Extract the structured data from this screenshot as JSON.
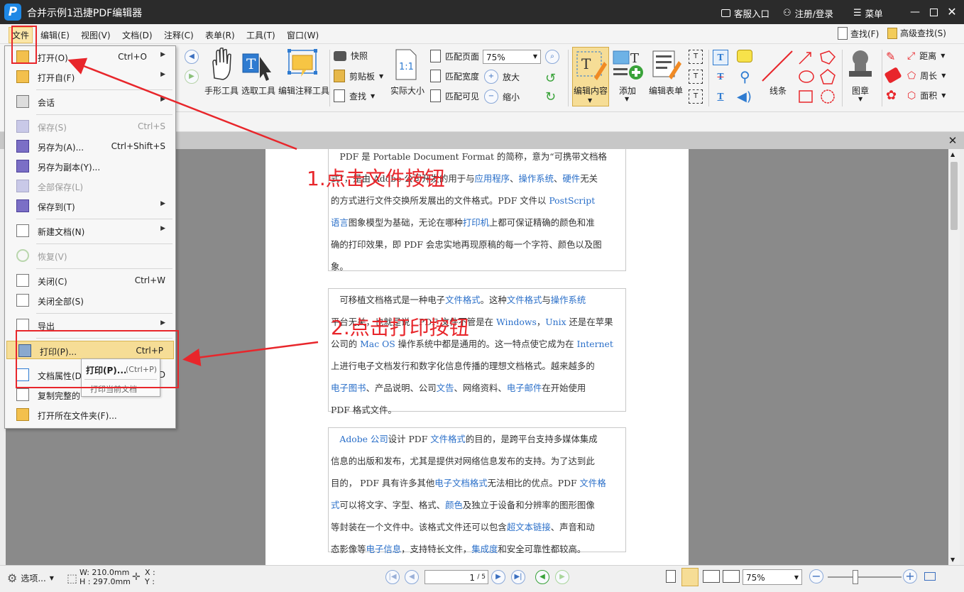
{
  "titlebar": {
    "logo": "P",
    "title": "合并示例1迅捷PDF编辑器",
    "service": "客服入口",
    "login": "注册/登录",
    "menu": "菜单"
  },
  "menubar": {
    "items": [
      "文件",
      "编辑(E)",
      "视图(V)",
      "文档(D)",
      "注释(C)",
      "表单(R)",
      "工具(T)",
      "窗口(W)"
    ],
    "find": "查找(F)",
    "advanced_find": "高级查找(S)"
  },
  "toolbar": {
    "hand": "手形工具",
    "select": "选取工具",
    "annot_edit": "编辑注释工具",
    "snapshot": "快照",
    "clipboard": "剪贴板",
    "find": "查找",
    "actual_size": "实际大小",
    "fit_page": "匹配页面",
    "fit_width": "匹配宽度",
    "fit_visible": "匹配可见",
    "zoom_value": "75%",
    "zoom_in": "放大",
    "zoom_out": "缩小",
    "edit_content": "编辑内容",
    "add": "添加",
    "edit_form": "编辑表单",
    "line": "线条",
    "stamp": "图章",
    "distance": "距离",
    "perimeter": "周长",
    "area": "面积"
  },
  "file_menu": {
    "open": {
      "label": "打开(O)...",
      "shortcut": "Ctrl+O"
    },
    "open_from": {
      "label": "打开自(F)"
    },
    "session": {
      "label": "会话"
    },
    "save": {
      "label": "保存(S)",
      "shortcut": "Ctrl+S"
    },
    "save_as": {
      "label": "另存为(A)...",
      "shortcut": "Ctrl+Shift+S"
    },
    "save_copy": {
      "label": "另存为副本(Y)..."
    },
    "save_all": {
      "label": "全部保存(L)"
    },
    "save_to": {
      "label": "保存到(T)"
    },
    "new_doc": {
      "label": "新建文档(N)"
    },
    "revert": {
      "label": "恢复(V)"
    },
    "close": {
      "label": "关闭(C)",
      "shortcut": "Ctrl+W"
    },
    "close_all": {
      "label": "关闭全部(S)"
    },
    "export": {
      "label": "导出"
    },
    "print": {
      "label": "打印(P)...",
      "shortcut": "Ctrl+P"
    },
    "doc_props": {
      "label": "文档属性(D",
      "shortcut": "D"
    },
    "copy_path": {
      "label": "复制完整的"
    },
    "open_folder": {
      "label": "打开所在文件夹(F)..."
    }
  },
  "tooltip": {
    "title": "打印(P)...",
    "shortcut": "(Ctrl+P)",
    "desc": "打印当前文档"
  },
  "annotations": {
    "step1": "1.点击文件按钮",
    "step2": "2.点击打印按钮",
    "color": "#e8262b"
  },
  "document": {
    "p1": [
      {
        "t": "　PDF 是 Portable Document Format 的简称，意为“可携带文档格"
      },
      {
        "t": "式”，是由 Adobe 公司开发的用于与",
        "l": "应用程序",
        "t2": "、",
        "l2": "操作系统",
        "t3": "、",
        "l3": "硬件",
        "t4": "无关"
      },
      {
        "t": "的方式进行文件交换所发展出的文件格式。PDF 文件以 ",
        "l": "PostScript"
      },
      {
        "l": "语言",
        "t": "图象模型为基础，无论在哪种",
        "l2": "打印机",
        "t2": "上都可保证精确的颜色和准"
      },
      {
        "t": "确的打印效果，即 PDF 会忠实地再现原稿的每一个字符、颜色以及图"
      },
      {
        "t": "象。"
      }
    ],
    "p2": [
      {
        "t": "　可移植文档格式是一种电子",
        "l": "文件格式",
        "t2": "。这种",
        "l2": "文件格式",
        "t3": "与",
        "l3": "操作系统"
      },
      {
        "t": "平台无关，也就是说，PDF 文件不管是在 ",
        "l": "Windows",
        "t2": "，",
        "l2": "Unix",
        "t3": " 还是在苹果"
      },
      {
        "t": "公司的 ",
        "l": "Mac OS",
        "t2": " 操作系统中都是通用的。这一特点使它成为在 ",
        "l2": "Internet"
      },
      {
        "t": "上进行电子文档发行和数字化信息传播的理想文档格式。越来越多的"
      },
      {
        "l": "电子图书",
        "t": "、产品说明、公司",
        "l2": "文告",
        "t2": "、网络资料、",
        "l3": "电子邮件",
        "t3": "在开始使用"
      },
      {
        "t": "PDF 格式文件。"
      }
    ],
    "p3": [
      {
        "t": "　",
        "l": "Adobe 公司",
        "t2": "设计 PDF ",
        "l2": "文件格式",
        "t3": "的目的，是跨平台支持多媒体集成"
      },
      {
        "t": "信息的出版和发布，尤其是提供对网络信息发布的支持。为了达到此"
      },
      {
        "t": "目的， PDF 具有许多其他",
        "l": "电子文档格式",
        "t2": "无法相比的优点。PDF ",
        "l2": "文件格"
      },
      {
        "l": "式",
        "t": "可以将文字、字型、格式、",
        "l2": "颜色",
        "t2": "及独立于设备和分辨率的图形图像"
      },
      {
        "t": "等封装在一个文件中。该格式文件还可以包含",
        "l": "超文本链接",
        "t2": "、声音和动"
      },
      {
        "t": "态影像等",
        "l": "电子信息",
        "t2": "，支持特长文件，",
        "l2": "集成度",
        "t3": "和安全可靠性都较高。"
      }
    ]
  },
  "statusbar": {
    "options": "选项...",
    "width": "W: 210.0mm",
    "height": "H : 297.0mm",
    "x": "X :",
    "y": "Y :",
    "page_current": "1",
    "page_total": "/ 5",
    "zoom": "75%"
  }
}
